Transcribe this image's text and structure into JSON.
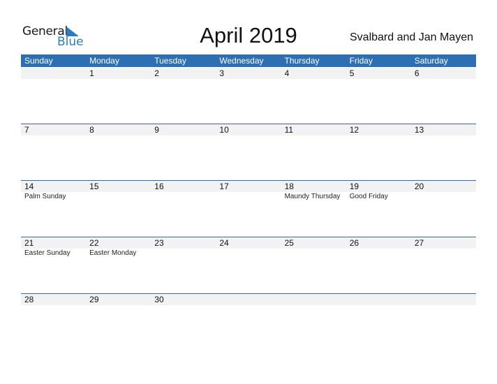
{
  "logo": {
    "word1": "General",
    "word2": "Blue",
    "accent_color": "#2a7bc4"
  },
  "title": "April 2019",
  "country": "Svalbard and Jan Mayen",
  "header_color": "#2e6fb4",
  "weekdays": [
    "Sunday",
    "Monday",
    "Tuesday",
    "Wednesday",
    "Thursday",
    "Friday",
    "Saturday"
  ],
  "weeks": [
    {
      "days": [
        {
          "num": "",
          "holiday": ""
        },
        {
          "num": "1",
          "holiday": ""
        },
        {
          "num": "2",
          "holiday": ""
        },
        {
          "num": "3",
          "holiday": ""
        },
        {
          "num": "4",
          "holiday": ""
        },
        {
          "num": "5",
          "holiday": ""
        },
        {
          "num": "6",
          "holiday": ""
        }
      ]
    },
    {
      "days": [
        {
          "num": "7",
          "holiday": ""
        },
        {
          "num": "8",
          "holiday": ""
        },
        {
          "num": "9",
          "holiday": ""
        },
        {
          "num": "10",
          "holiday": ""
        },
        {
          "num": "11",
          "holiday": ""
        },
        {
          "num": "12",
          "holiday": ""
        },
        {
          "num": "13",
          "holiday": ""
        }
      ]
    },
    {
      "days": [
        {
          "num": "14",
          "holiday": "Palm Sunday"
        },
        {
          "num": "15",
          "holiday": ""
        },
        {
          "num": "16",
          "holiday": ""
        },
        {
          "num": "17",
          "holiday": ""
        },
        {
          "num": "18",
          "holiday": "Maundy Thursday"
        },
        {
          "num": "19",
          "holiday": "Good Friday"
        },
        {
          "num": "20",
          "holiday": ""
        }
      ]
    },
    {
      "days": [
        {
          "num": "21",
          "holiday": "Easter Sunday"
        },
        {
          "num": "22",
          "holiday": "Easter Monday"
        },
        {
          "num": "23",
          "holiday": ""
        },
        {
          "num": "24",
          "holiday": ""
        },
        {
          "num": "25",
          "holiday": ""
        },
        {
          "num": "26",
          "holiday": ""
        },
        {
          "num": "27",
          "holiday": ""
        }
      ]
    },
    {
      "days": [
        {
          "num": "28",
          "holiday": ""
        },
        {
          "num": "29",
          "holiday": ""
        },
        {
          "num": "30",
          "holiday": ""
        },
        {
          "num": "",
          "holiday": ""
        },
        {
          "num": "",
          "holiday": ""
        },
        {
          "num": "",
          "holiday": ""
        },
        {
          "num": "",
          "holiday": ""
        }
      ]
    }
  ]
}
